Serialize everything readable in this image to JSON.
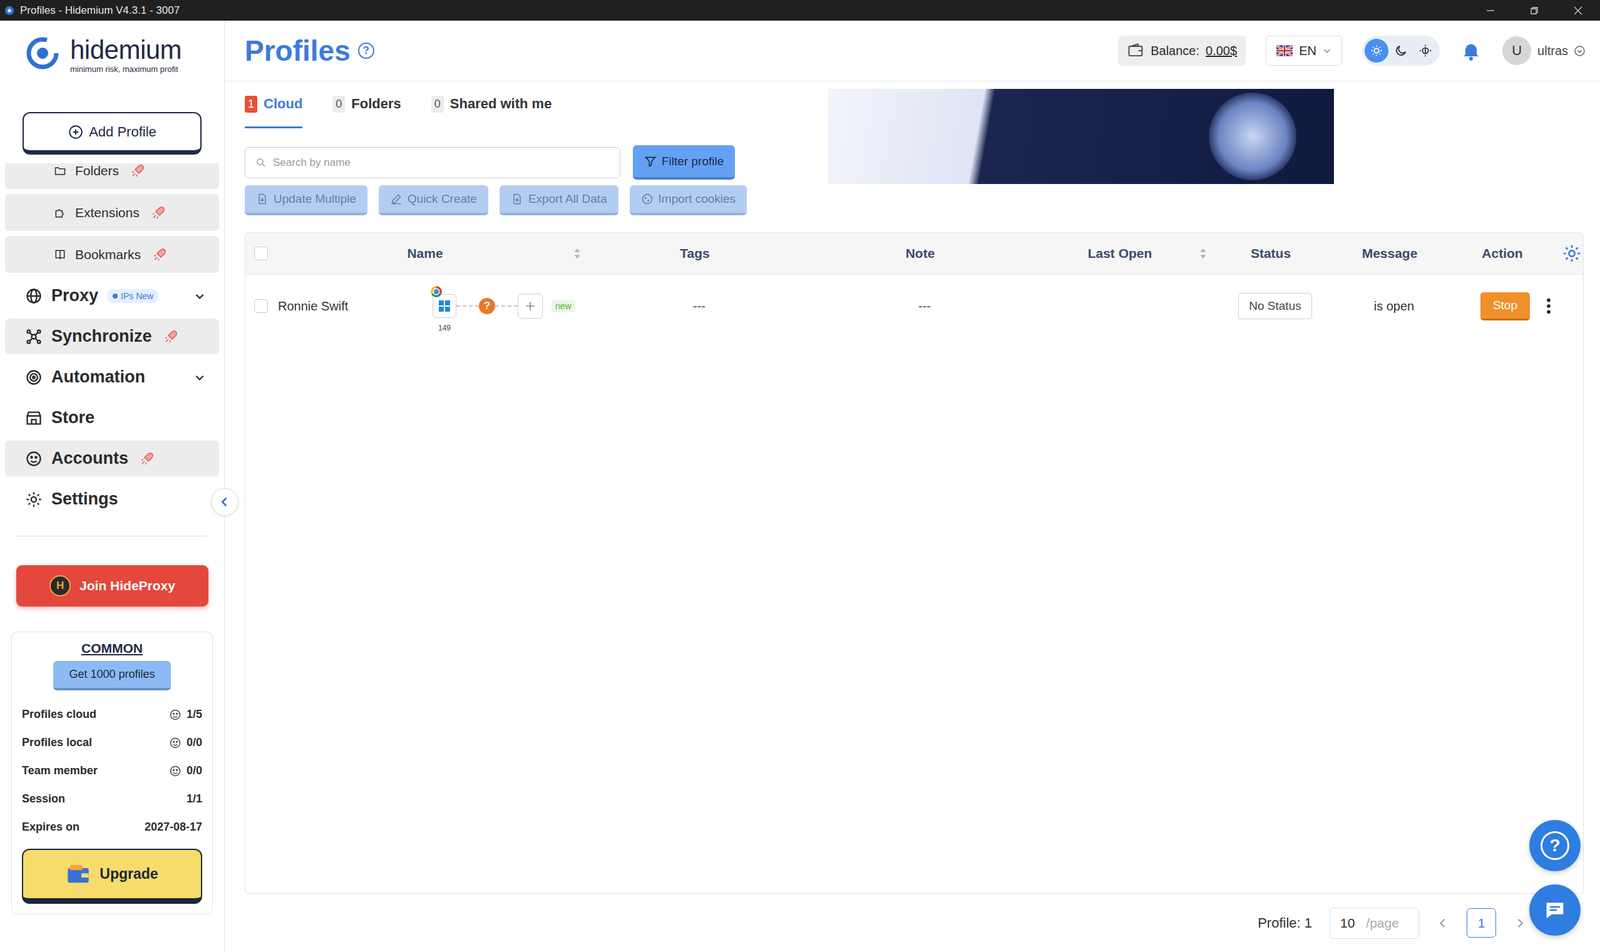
{
  "window": {
    "title": "Profiles - Hidemium V4.3.1 - 3007"
  },
  "logo": {
    "name": "hidemium",
    "tagline": "minimum risk, maximum profit"
  },
  "sidebar": {
    "add_button": "Add Profile",
    "items": [
      {
        "label": "Folders",
        "kind": "sub",
        "premium": true,
        "expandable": false,
        "badge": ""
      },
      {
        "label": "Extensions",
        "kind": "sub",
        "premium": true,
        "expandable": false,
        "badge": ""
      },
      {
        "label": "Bookmarks",
        "kind": "sub",
        "premium": true,
        "expandable": false,
        "badge": ""
      },
      {
        "label": "Proxy",
        "kind": "main",
        "premium": false,
        "expandable": true,
        "badge": "IPs New"
      },
      {
        "label": "Synchronize",
        "kind": "main",
        "premium": true,
        "expandable": false,
        "badge": ""
      },
      {
        "label": "Automation",
        "kind": "main",
        "premium": false,
        "expandable": true,
        "badge": ""
      },
      {
        "label": "Store",
        "kind": "main",
        "premium": false,
        "expandable": false,
        "badge": ""
      },
      {
        "label": "Accounts",
        "kind": "main",
        "premium": true,
        "expandable": false,
        "badge": ""
      },
      {
        "label": "Settings",
        "kind": "main",
        "premium": false,
        "expandable": false,
        "badge": ""
      }
    ],
    "promo_button": "Join HideProxy",
    "promo_logo": "H",
    "plan": {
      "name": "COMMON",
      "cta": "Get 1000 profiles",
      "rows": [
        {
          "label": "Profiles cloud",
          "value": "1/5"
        },
        {
          "label": "Profiles local",
          "value": "0/0"
        },
        {
          "label": "Team member",
          "value": "0/0"
        },
        {
          "label": "Session",
          "value": "1/1"
        },
        {
          "label": "Expires on",
          "value": "2027-08-17"
        }
      ],
      "upgrade": "Upgrade"
    }
  },
  "header": {
    "title": "Profiles",
    "help_icon": "?",
    "balance_label": "Balance:",
    "balance": "0.00$",
    "language": "EN",
    "themes": [
      {
        "selected": true
      },
      {
        "selected": false
      },
      {
        "selected": false
      }
    ],
    "user": {
      "initial": "U",
      "name": "ultras"
    }
  },
  "tabs": [
    {
      "count": "1",
      "label": "Cloud",
      "selected": true
    },
    {
      "count": "0",
      "label": "Folders",
      "selected": false
    },
    {
      "count": "0",
      "label": "Shared with me",
      "selected": false
    }
  ],
  "search": {
    "placeholder": "Search by name"
  },
  "filter_button": "Filter profile",
  "actions": [
    {
      "label": "Update Multiple",
      "disabled": true
    },
    {
      "label": "Quick Create",
      "disabled": true
    },
    {
      "label": "Export All Data",
      "disabled": true
    },
    {
      "label": "Import cookies",
      "disabled": true
    }
  ],
  "table": {
    "all_checked": false,
    "columns": [
      {
        "label": "Name",
        "sortable": true
      },
      {
        "label": "Tags",
        "sortable": false
      },
      {
        "label": "Note",
        "sortable": false
      },
      {
        "label": "Last Open",
        "sortable": true
      },
      {
        "label": "Status",
        "sortable": false
      },
      {
        "label": "Message",
        "sortable": false
      },
      {
        "label": "Action",
        "sortable": false
      }
    ],
    "rows": [
      {
        "name": "Ronnie Swift",
        "checked": false,
        "os_version": "149",
        "proxy": "?",
        "tag": "new",
        "tags": "---",
        "note": "---",
        "status": "No Status",
        "message": "is open",
        "action": "Stop"
      }
    ]
  },
  "pagination": {
    "total_label": "Profile:",
    "total": "1",
    "page_size": "10",
    "page_size_suffix": "/page",
    "pages": [
      {
        "label": "1",
        "selected": true
      }
    ]
  },
  "help_fab": "?"
}
